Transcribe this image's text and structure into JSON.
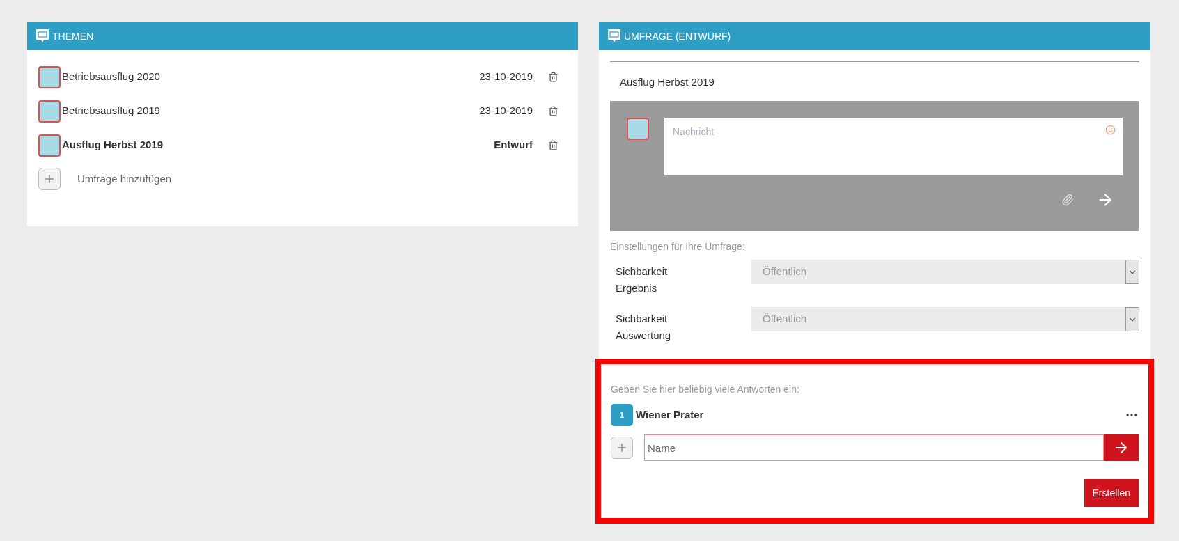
{
  "topics_panel": {
    "title": "THEMEN",
    "topics": [
      {
        "title": "Betriebsausflug 2020",
        "status": "23-10-2019",
        "draft": false
      },
      {
        "title": "Betriebsausflug 2019",
        "status": "23-10-2019",
        "draft": false
      },
      {
        "title": "Ausflug Herbst 2019",
        "status": "Entwurf",
        "draft": true
      }
    ],
    "add_label": "Umfrage hinzufügen"
  },
  "survey_panel": {
    "title": "UMFRAGE (ENTWURF)",
    "survey_title": "Ausflug Herbst 2019",
    "message": {
      "placeholder": "Nachricht"
    },
    "settings_label": "Einstellungen für Ihre Umfrage:",
    "settings": [
      {
        "label": "Sichbarkeit Ergebnis",
        "value": "Öffentlich"
      },
      {
        "label": "Sichbarkeit Auswertung",
        "value": "Öffentlich"
      }
    ],
    "answers_hint": "Geben Sie hier beliebig viele Antworten ein:",
    "answers": [
      {
        "number": "1",
        "text": "Wiener Prater"
      }
    ],
    "answer_input": {
      "placeholder": "Name"
    },
    "create_button": "Erstellen"
  }
}
